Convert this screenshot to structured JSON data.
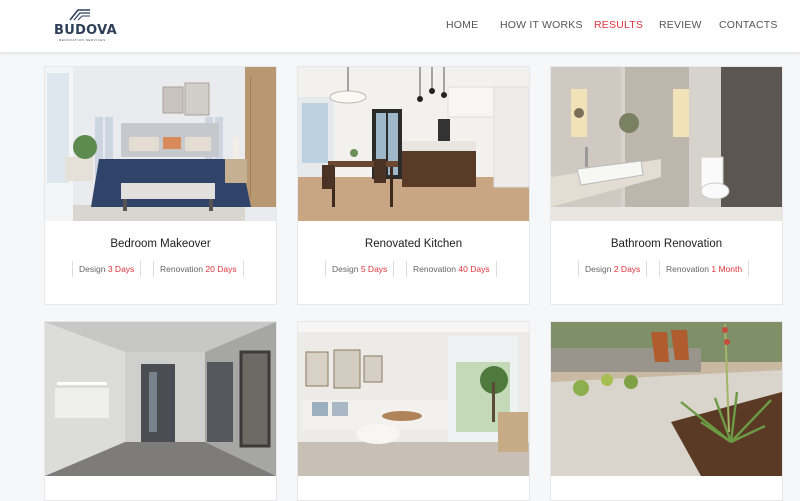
{
  "brand": {
    "name": "BUDOVA",
    "tagline": "RENOVATION SERVICES"
  },
  "nav": [
    {
      "label": "HOME",
      "active": false
    },
    {
      "label": "HOW IT WORKS",
      "active": false
    },
    {
      "label": "RESULTS",
      "active": true
    },
    {
      "label": "REVIEW",
      "active": false
    },
    {
      "label": "CONTACTS",
      "active": false
    }
  ],
  "cards": [
    {
      "title": "Bedroom Makeover",
      "design_label": "Design",
      "design_value": "3 Days",
      "renovation_label": "Renovation",
      "renovation_value": "20 Days"
    },
    {
      "title": "Renovated Kitchen",
      "design_label": "Design",
      "design_value": "5 Days",
      "renovation_label": "Renovation",
      "renovation_value": "40 Days"
    },
    {
      "title": "Bathroom Renovation",
      "design_label": "Design",
      "design_value": "2 Days",
      "renovation_label": "Renovation",
      "renovation_value": "1 Month"
    },
    {
      "title": ""
    },
    {
      "title": ""
    },
    {
      "title": ""
    }
  ],
  "colors": {
    "accent": "#e0343c",
    "brand": "#2d3e58",
    "nav_text": "#555555"
  }
}
